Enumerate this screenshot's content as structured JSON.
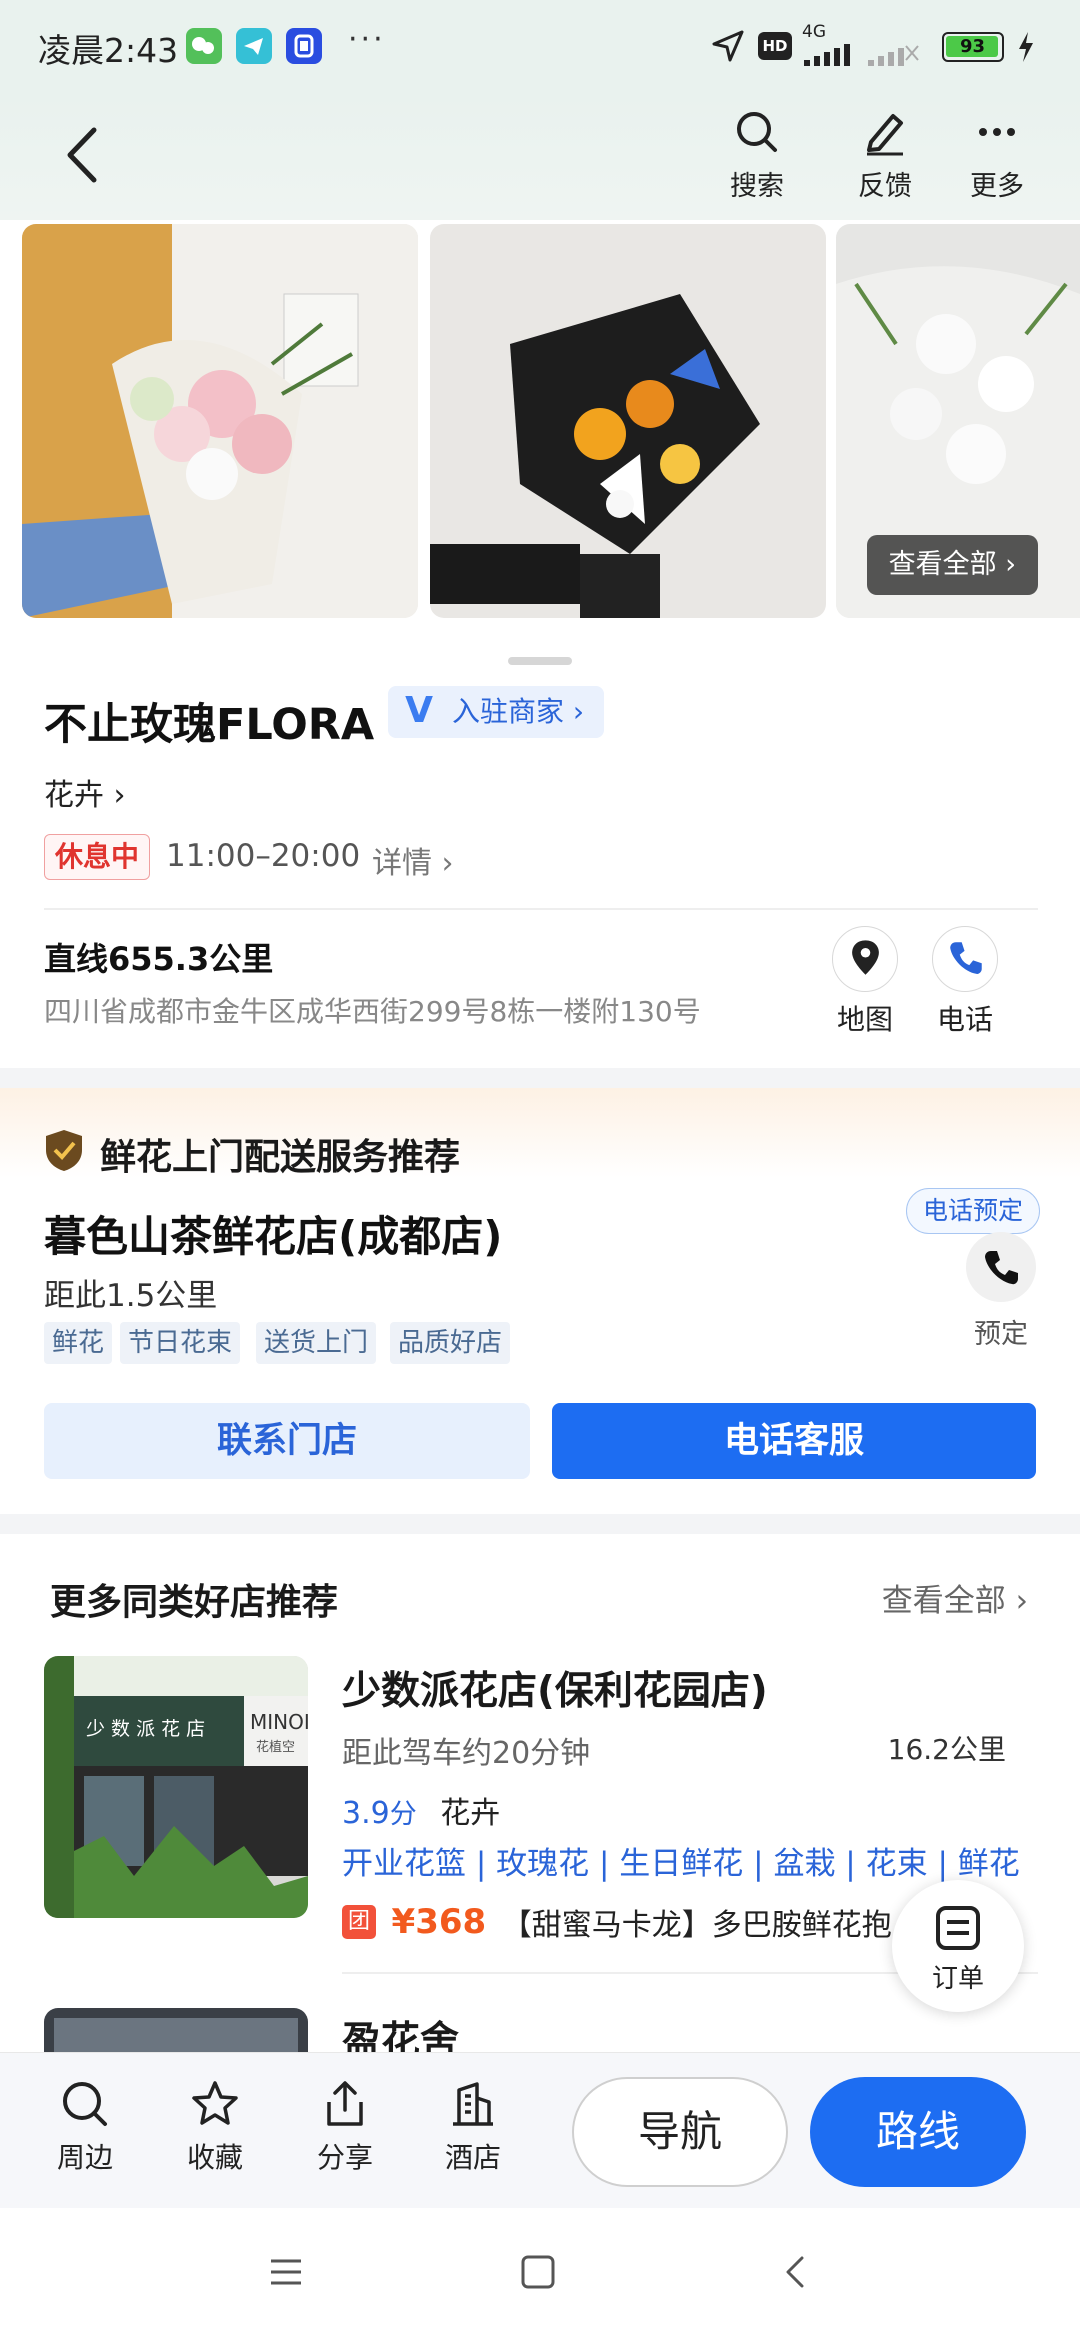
{
  "status_bar": {
    "time": "凌晨2:43",
    "more": "···",
    "hd": "HD",
    "network": "4G",
    "battery": "93"
  },
  "header": {
    "search_label": "搜索",
    "feedback_label": "反馈",
    "more_label": "更多"
  },
  "photos": {
    "view_all": "查看全部 ›"
  },
  "place": {
    "name": "不止玫瑰FLORA",
    "verified_label": "入驻商家 ›",
    "category": "花卉 ›",
    "status": "休息中",
    "hours": "11:00–20:00",
    "hours_detail": "详情 ›",
    "distance": "直线655.3公里",
    "address": "四川省成都市金牛区成华西街299号8栋一楼附130号",
    "map_label": "地图",
    "phone_label": "电话"
  },
  "recommend": {
    "title": "鲜花上门配送服务推荐",
    "shop_name": "暮色山茶鲜花店(成都店)",
    "distance": "距此1.5公里",
    "tags": [
      "鲜花",
      "节日花束",
      "送货上门",
      "品质好店"
    ],
    "phone_badge": "电话预定",
    "book_label": "预定",
    "contact_button": "联系门店",
    "service_button": "电话客服"
  },
  "more_shops": {
    "title": "更多同类好店推荐",
    "view_all": "查看全部 ›",
    "items": [
      {
        "name": "少数派花店(保利花园店)",
        "drive": "距此驾车约20分钟",
        "km": "16.2公里",
        "score": "3.9",
        "score_unit": "分",
        "category": "花卉",
        "tags": "开业花篮 | 玫瑰花 | 生日鲜花 | 盆栽 | 花束 | 鲜花",
        "deal_icon": "团",
        "price": "¥368",
        "deal": "【甜蜜马卡龙】多巴胺鲜花抱",
        "thumb_sign": "少 数 派 花 店",
        "thumb_logo": "MINOI",
        "thumb_logo_sub": "花植空"
      },
      {
        "name": "盈花舍"
      }
    ]
  },
  "order_float": {
    "label": "订单"
  },
  "bottom_bar": {
    "nearby": "周边",
    "favorite": "收藏",
    "share": "分享",
    "hotel": "酒店",
    "navigate": "导航",
    "route": "路线"
  },
  "colors": {
    "accent": "#1d6df2",
    "link": "#2a64d8",
    "price": "#f25a1e",
    "closed": "#e0342f"
  }
}
